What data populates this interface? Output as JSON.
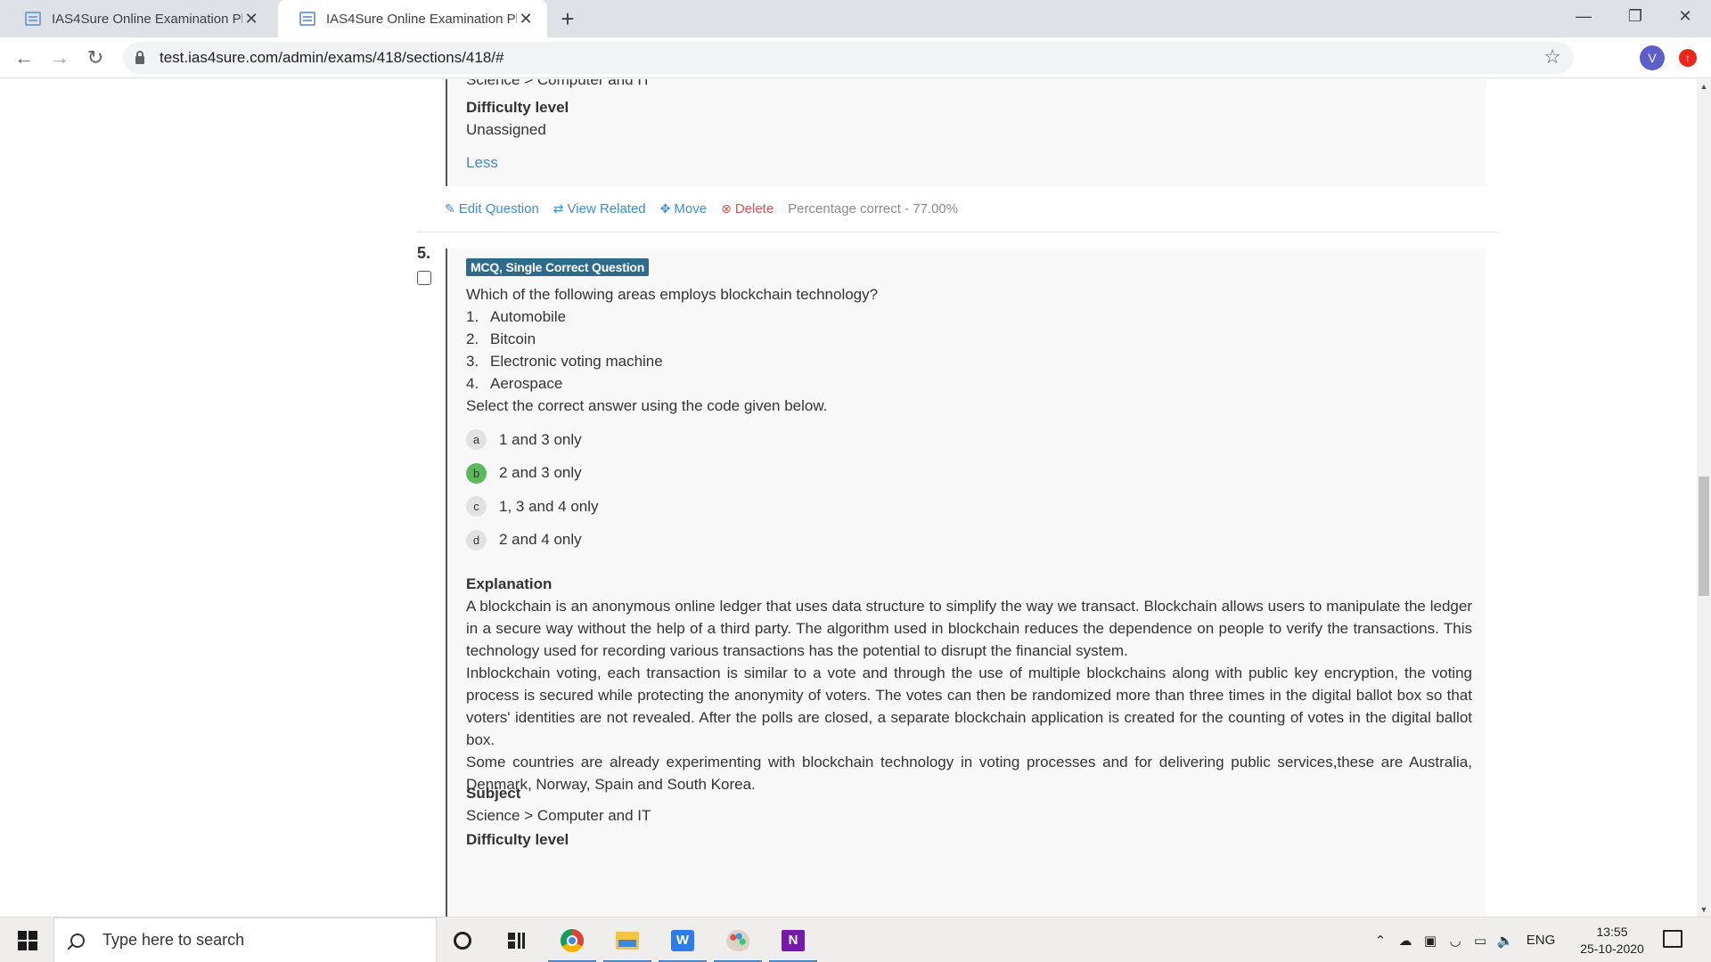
{
  "browser": {
    "tabs": [
      {
        "title": "IAS4Sure Online Examination Platform",
        "active": false
      },
      {
        "title": "IAS4Sure Online Examination Platform",
        "active": true
      }
    ],
    "url": "test.ias4sure.com/admin/exams/418/sections/418/#",
    "profile_initial": "V"
  },
  "previous_question": {
    "cutoff_text": "Science > Computer and IT",
    "difficulty_label": "Difficulty level",
    "difficulty_value": "Unassigned",
    "less_link": "Less",
    "actions": {
      "edit": "Edit Question",
      "view_related": "View Related",
      "move": "Move",
      "delete": "Delete",
      "percentage": "Percentage correct - 77.00%"
    }
  },
  "question": {
    "number": "5.",
    "type_badge": "MCQ, Single Correct Question",
    "stem": "Which of the following areas employs blockchain technology?",
    "statements": [
      {
        "num": "1.",
        "text": "Automobile"
      },
      {
        "num": "2.",
        "text": "Bitcoin"
      },
      {
        "num": "3.",
        "text": "Electronic voting machine"
      },
      {
        "num": "4.",
        "text": "Aerospace"
      }
    ],
    "instruction": "Select the correct answer using the code given below.",
    "options": [
      {
        "letter": "a",
        "text": "1 and 3 only",
        "correct": false
      },
      {
        "letter": "b",
        "text": "2 and 3 only",
        "correct": true
      },
      {
        "letter": "c",
        "text": "1, 3 and 4 only",
        "correct": false
      },
      {
        "letter": "d",
        "text": "2 and 4 only",
        "correct": false
      }
    ],
    "explanation_label": "Explanation",
    "explanation": [
      "A blockchain is an anonymous online ledger that uses data structure to simplify the way we transact. Blockchain allows users to manipulate the ledger in a secure way without the help of a third party. The algorithm used in blockchain reduces the dependence on people to verify the transactions. This technology used for recording various transactions has the potential to disrupt the financial system.",
      "Inblockchain voting, each transaction is similar to a vote and through the use of multiple blockchains along with public key encryption, the voting process is secured while protecting the anonymity of voters. The votes can then be randomized more than three times in the digital ballot box so that voters' identities are not revealed. After the polls are closed, a separate blockchain application is created for the counting of votes in the digital ballot box.",
      "Some countries are already experimenting with blockchain technology in voting processes and for delivering public services,these are Australia, Denmark, Norway, Spain and South Korea."
    ],
    "subject_label": "Subject",
    "subject_value": "Science > Computer and IT",
    "difficulty_label": "Difficulty level"
  },
  "taskbar": {
    "search_placeholder": "Type here to search",
    "language": "ENG",
    "time": "13:55",
    "date": "25-10-2020"
  },
  "colors": {
    "link": "#3f8ad6",
    "delete": "#d9534f",
    "badge": "#2e6a8e",
    "correct": "#5cb85c"
  }
}
